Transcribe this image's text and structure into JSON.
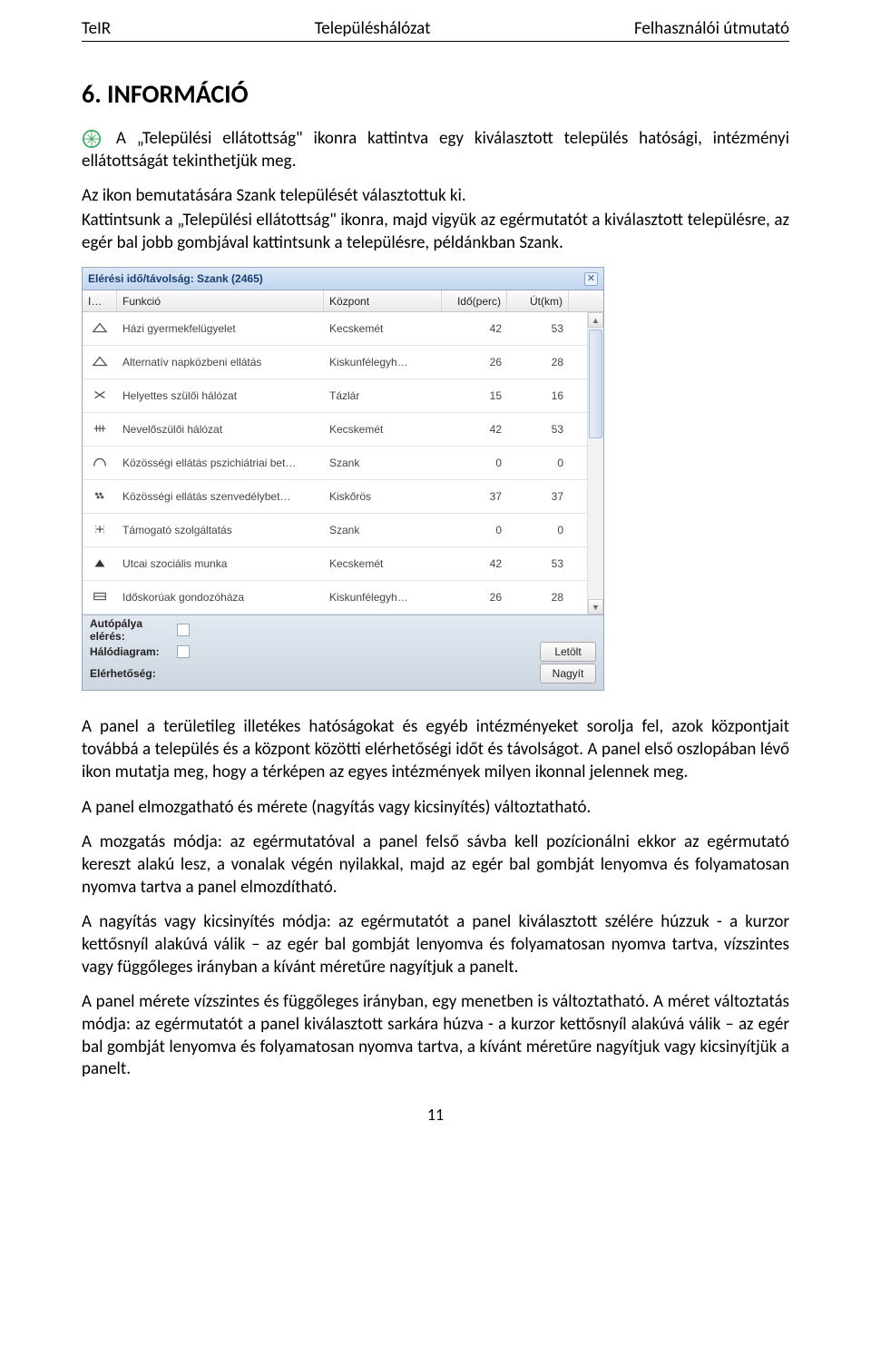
{
  "header": {
    "left": "TeIR",
    "center": "Településhálózat",
    "right": "Felhasználói útmutató"
  },
  "heading": "6. INFORMÁCIÓ",
  "intro": {
    "p1a": "A „Települési ellátottság\" ikonra kattintva egy kiválasztott település hatósági, intézményi ellátottságát tekinthetjük meg.",
    "p2": "Az ikon bemutatására Szank települését választottuk ki.",
    "p3": "Kattintsunk a „Települési ellátottság\" ikonra, majd vigyük az egérmutatót a kiválasztott településre, az egér bal jobb gombjával kattintsunk a településre, példánkban Szank."
  },
  "panel": {
    "title": "Elérési idő/távolság: Szank (2465)",
    "columns": {
      "icon": "I…",
      "func": "Funkció",
      "center": "Központ",
      "time": "Idő(perc)",
      "dist": "Út(km)"
    },
    "rows": [
      {
        "iconType": "tri-open",
        "func": "Házi gyermekfelügyelet",
        "center": "Kecskemét",
        "time": "42",
        "dist": "53"
      },
      {
        "iconType": "tri-open",
        "func": "Alternatív napközbeni ellátás",
        "center": "Kiskunfélegyh…",
        "time": "26",
        "dist": "28"
      },
      {
        "iconType": "cross",
        "func": "Helyettes szülői hálózat",
        "center": "Tázlár",
        "time": "15",
        "dist": "16"
      },
      {
        "iconType": "tally",
        "func": "Nevelőszülői hálózat",
        "center": "Kecskemét",
        "time": "42",
        "dist": "53"
      },
      {
        "iconType": "arc",
        "func": "Közösségi ellátás pszichiátriai bet…",
        "center": "Szank",
        "time": "0",
        "dist": "0"
      },
      {
        "iconType": "grapes",
        "func": "Közösségi ellátás szenvedélybet…",
        "center": "Kiskőrös",
        "time": "37",
        "dist": "37"
      },
      {
        "iconType": "plus",
        "func": "Támogató szolgáltatás",
        "center": "Szank",
        "time": "0",
        "dist": "0"
      },
      {
        "iconType": "solid",
        "func": "Utcai szociális munka",
        "center": "Kecskemét",
        "time": "42",
        "dist": "53"
      },
      {
        "iconType": "bars",
        "func": "Időskorúak gondozóháza",
        "center": "Kiskunfélegyh…",
        "time": "26",
        "dist": "28"
      }
    ],
    "footer": {
      "labels": {
        "highway": "Autópálya elérés:",
        "diagram": "Hálódiagram:",
        "reach": "Elérhetőség:"
      },
      "buttons": {
        "download": "Letölt",
        "zoom": "Nagyít"
      }
    }
  },
  "below": {
    "p1": "A panel a területileg illetékes hatóságokat és egyéb intézményeket sorolja fel, azok központjait továbbá a település és a központ közötti elérhetőségi időt és távolságot. A panel első oszlopában lévő ikon mutatja meg, hogy a térképen az egyes intézmények milyen ikonnal jelennek meg.",
    "p2": "A panel elmozgatható és mérete (nagyítás vagy kicsinyítés) változtatható.",
    "p3": "A mozgatás módja: az egérmutatóval a panel felső sávba kell pozícionálni ekkor az egérmutató kereszt alakú lesz, a vonalak végén nyilakkal, majd az egér bal gombját lenyomva és folyamatosan nyomva tartva a panel elmozdítható.",
    "p4": "A nagyítás vagy kicsinyítés módja: az egérmutatót a panel kiválasztott szélére húzzuk - a kurzor kettősnyíl alakúvá válik – az egér bal gombját lenyomva és folyamatosan nyomva tartva, vízszintes vagy függőleges irányban a kívánt méretűre nagyítjuk a panelt.",
    "p5": "A panel mérete vízszintes és függőleges irányban, egy menetben is változtatható. A méret változtatás módja: az egérmutatót a panel kiválasztott sarkára húzva - a kurzor kettősnyíl alakúvá válik – az egér bal gombját lenyomva és folyamatosan nyomva tartva, a kívánt méretűre nagyítjuk vagy kicsinyítjük a panelt."
  },
  "pageNumber": "11"
}
